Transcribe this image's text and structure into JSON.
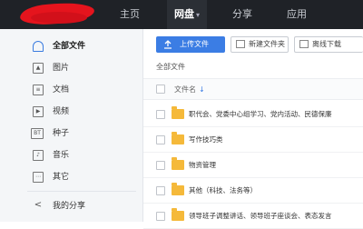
{
  "topbar": {
    "nav": [
      {
        "label": "主页"
      },
      {
        "label": "网盘"
      },
      {
        "label": "分享"
      },
      {
        "label": "应用"
      }
    ]
  },
  "sidebar": {
    "items": [
      {
        "label": "全部文件",
        "icon": "all-files-icon"
      },
      {
        "label": "图片",
        "icon": "image-icon"
      },
      {
        "label": "文档",
        "icon": "document-icon"
      },
      {
        "label": "视频",
        "icon": "video-icon"
      },
      {
        "label": "种子",
        "icon": "torrent-icon",
        "icon_text": "BT"
      },
      {
        "label": "音乐",
        "icon": "music-icon"
      },
      {
        "label": "其它",
        "icon": "other-icon"
      },
      {
        "label": "我的分享",
        "icon": "share-icon"
      }
    ]
  },
  "toolbar": {
    "upload_label": "上传文件",
    "new_folder_label": "新建文件夹",
    "offline_download_label": "离线下载"
  },
  "breadcrumb": "全部文件",
  "list": {
    "column_name": "文件名",
    "sort_glyph": "↓",
    "rows": [
      {
        "name": "职代会、党委中心组学习、党内活动、民德保廉"
      },
      {
        "name": "写作技巧类"
      },
      {
        "name": "物资管理"
      },
      {
        "name": "其他（科技、法务等）"
      },
      {
        "name": "领导班子调整讲话、领导班子座谈会、表态发言"
      }
    ]
  },
  "colors": {
    "topbar": "#1f2227",
    "accent": "#3b7de4",
    "folder": "#f5b93a",
    "logo_red": "#e5141d"
  }
}
